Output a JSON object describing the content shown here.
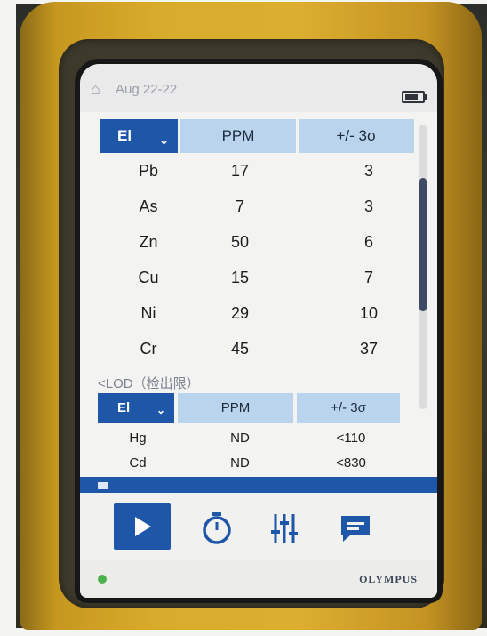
{
  "status_bar": {
    "home_icon": "home-icon",
    "date": "Aug 22-22",
    "battery_icon": "battery-icon"
  },
  "results_table": {
    "headers": {
      "el": "El",
      "ppm": "PPM",
      "error": "+/- 3σ"
    },
    "rows": [
      {
        "el": "Pb",
        "ppm": "17",
        "error": "3"
      },
      {
        "el": "As",
        "ppm": "7",
        "error": "3"
      },
      {
        "el": "Zn",
        "ppm": "50",
        "error": "6"
      },
      {
        "el": "Cu",
        "ppm": "15",
        "error": "7"
      },
      {
        "el": "Ni",
        "ppm": "29",
        "error": "10"
      },
      {
        "el": "Cr",
        "ppm": "45",
        "error": "37"
      }
    ]
  },
  "lod_section": {
    "label": "<LOD（检出限）",
    "headers": {
      "el": "El",
      "ppm": "PPM",
      "error": "+/- 3σ"
    },
    "rows": [
      {
        "el": "Hg",
        "ppm": "ND",
        "error": "<110"
      },
      {
        "el": "Cd",
        "ppm": "ND",
        "error": "<830"
      }
    ]
  },
  "toolbar": {
    "play_icon": "play-icon",
    "timer_icon": "timer-icon",
    "settings_icon": "sliders-icon",
    "message_icon": "message-icon"
  },
  "footer": {
    "status_dot_color": "#4bb14b",
    "brand": "OLYMPUS"
  },
  "colors": {
    "accent_blue": "#1f57a8",
    "header_light_blue": "#b9d4ec",
    "device_yellow": "#d9ab2c"
  }
}
